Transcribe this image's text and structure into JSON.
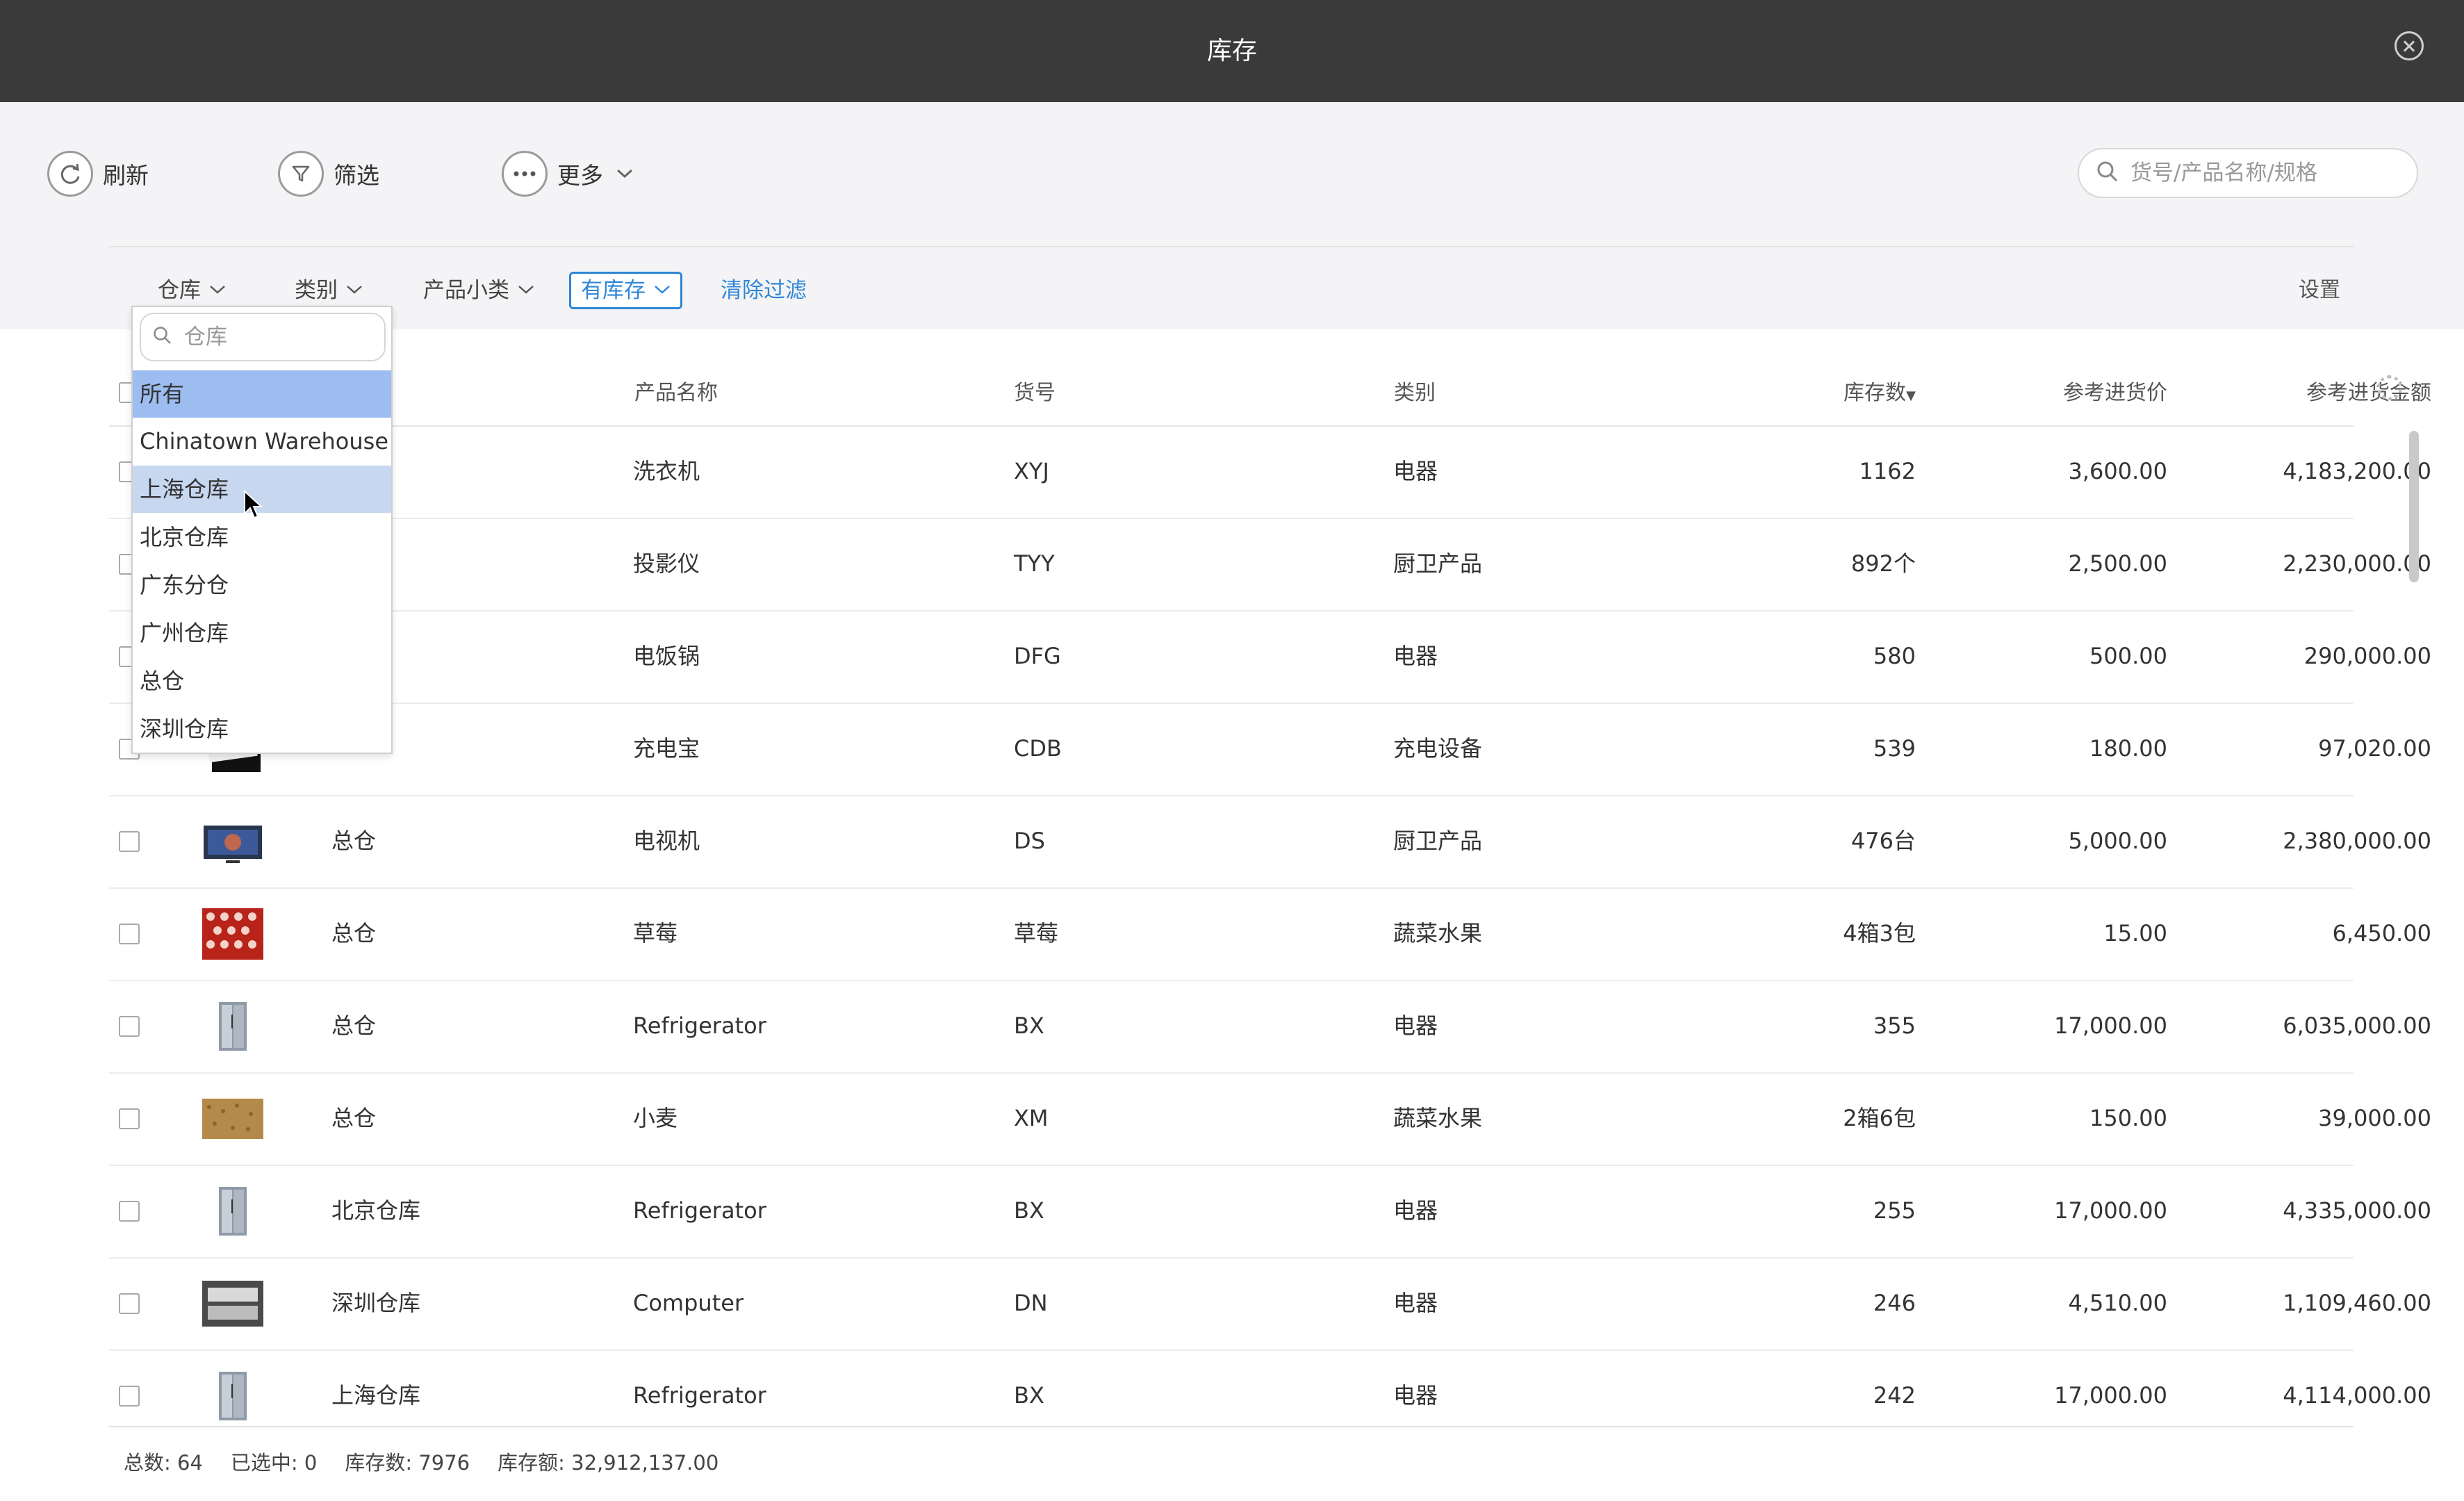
{
  "window": {
    "title": "库存"
  },
  "toolbar": {
    "refresh": "刷新",
    "filter": "筛选",
    "more": "更多",
    "search_placeholder": "货号/产品名称/规格"
  },
  "filters": {
    "warehouse": "仓库",
    "category": "类别",
    "subcategory": "产品小类",
    "in_stock": "有库存",
    "clear": "清除过滤",
    "settings": "设置"
  },
  "table": {
    "headers": {
      "product_name": "产品名称",
      "sku": "货号",
      "category": "类别",
      "stock": "库存数",
      "ref_price": "参考进货价",
      "ref_amount": "参考进货金额"
    },
    "rows": [
      {
        "warehouse": "",
        "product": "洗衣机",
        "sku": "XYJ",
        "category": "电器",
        "stock": "1162",
        "price": "3,600.00",
        "amount": "4,183,200.00",
        "thumb": "washer-thumb"
      },
      {
        "warehouse": "",
        "product": "投影仪",
        "sku": "TYY",
        "category": "厨卫产品",
        "stock": "892个",
        "price": "2,500.00",
        "amount": "2,230,000.00",
        "thumb": "projector-thumb"
      },
      {
        "warehouse": "",
        "product": "电饭锅",
        "sku": "DFG",
        "category": "电器",
        "stock": "580",
        "price": "500.00",
        "amount": "290,000.00",
        "thumb": "rice-cooker-thumb"
      },
      {
        "warehouse": "",
        "product": "充电宝",
        "sku": "CDB",
        "category": "充电设备",
        "stock": "539",
        "price": "180.00",
        "amount": "97,020.00",
        "thumb": "power-bank-thumb"
      },
      {
        "warehouse": "总仓",
        "product": "电视机",
        "sku": "DS",
        "category": "厨卫产品",
        "stock": "476台",
        "price": "5,000.00",
        "amount": "2,380,000.00",
        "thumb": "tv-thumb"
      },
      {
        "warehouse": "总仓",
        "product": "草莓",
        "sku": "草莓",
        "category": "蔬菜水果",
        "stock": "4箱3包",
        "price": "15.00",
        "amount": "6,450.00",
        "thumb": "strawberry-thumb"
      },
      {
        "warehouse": "总仓",
        "product": "Refrigerator",
        "sku": "BX",
        "category": "电器",
        "stock": "355",
        "price": "17,000.00",
        "amount": "6,035,000.00",
        "thumb": "fridge-thumb"
      },
      {
        "warehouse": "总仓",
        "product": "小麦",
        "sku": "XM",
        "category": "蔬菜水果",
        "stock": "2箱6包",
        "price": "150.00",
        "amount": "39,000.00",
        "thumb": "wheat-thumb"
      },
      {
        "warehouse": "北京仓库",
        "product": "Refrigerator",
        "sku": "BX",
        "category": "电器",
        "stock": "255",
        "price": "17,000.00",
        "amount": "4,335,000.00",
        "thumb": "fridge-thumb"
      },
      {
        "warehouse": "深圳仓库",
        "product": "Computer",
        "sku": "DN",
        "category": "电器",
        "stock": "246",
        "price": "4,510.00",
        "amount": "1,109,460.00",
        "thumb": "computer-thumb"
      },
      {
        "warehouse": "上海仓库",
        "product": "Refrigerator",
        "sku": "BX",
        "category": "电器",
        "stock": "242",
        "price": "17,000.00",
        "amount": "4,114,000.00",
        "thumb": "fridge-thumb"
      }
    ]
  },
  "dropdown": {
    "search_placeholder": "仓库",
    "items": [
      "所有",
      "Chinatown Warehouse",
      "上海仓库",
      "北京仓库",
      "广东分仓",
      "广州仓库",
      "总仓",
      "深圳仓库"
    ],
    "selected": "所有",
    "hovered": "上海仓库"
  },
  "footer": {
    "total": "总数: 64",
    "selected": "已选中: 0",
    "stock_count": "库存数: 7976",
    "stock_amount": "库存额: 32,912,137.00"
  },
  "colors": {
    "titlebar": "#3a3a3a",
    "accent": "#2f86d6",
    "selected_item": "#9dbdf0",
    "hover_item": "#c7d7f0"
  }
}
